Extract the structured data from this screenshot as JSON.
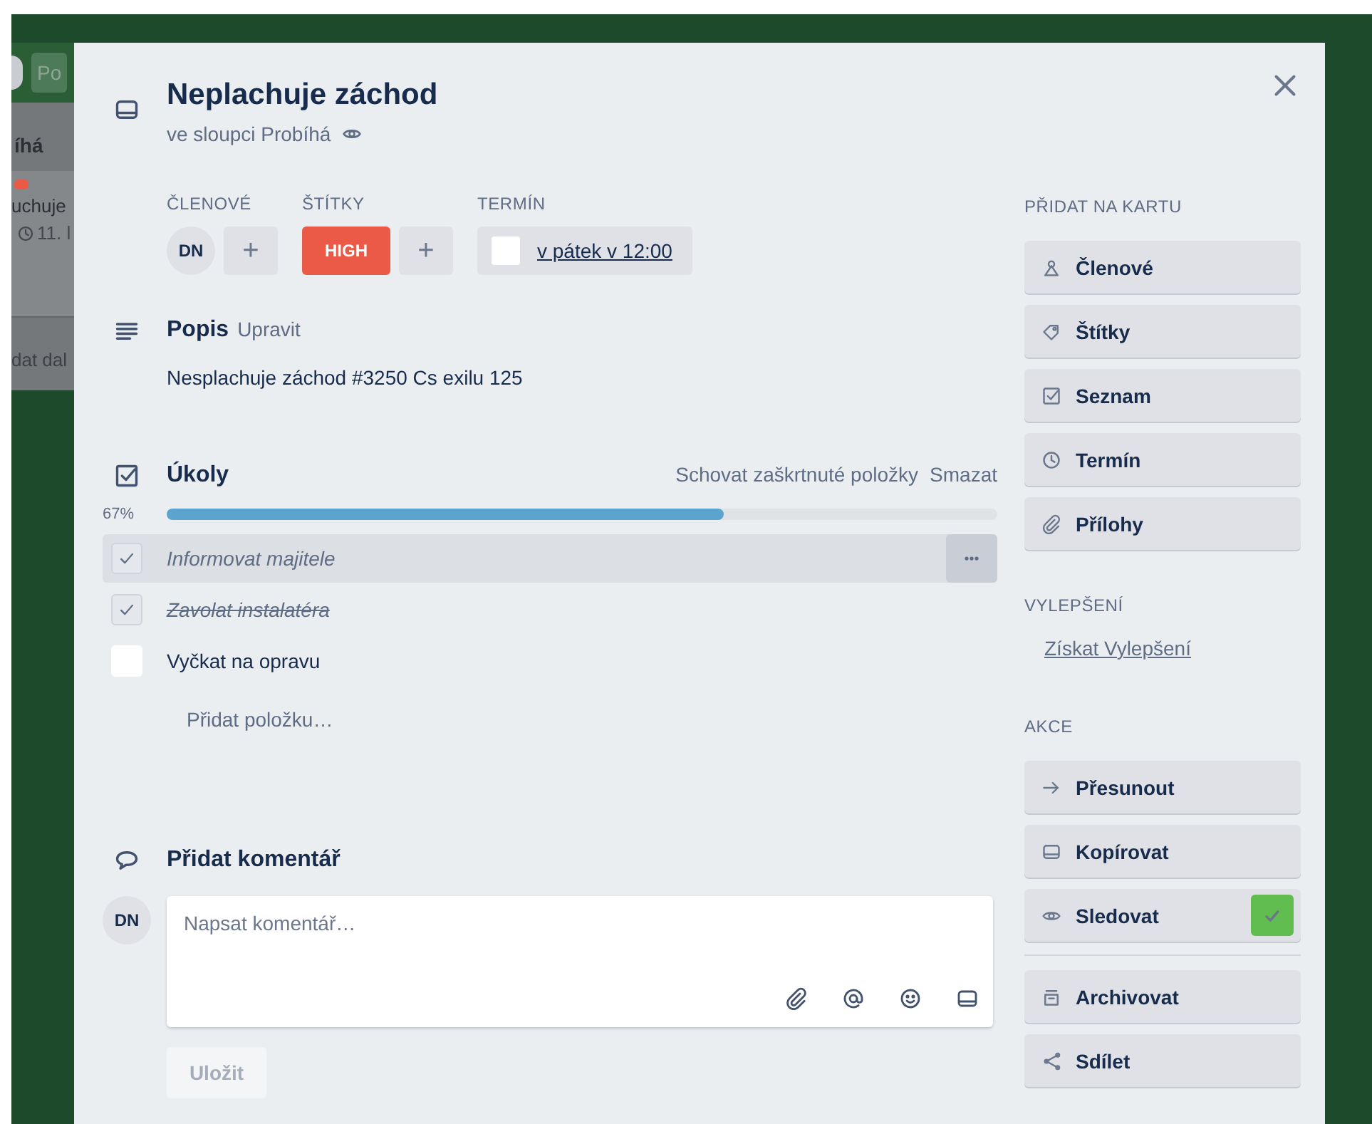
{
  "board": {
    "header_button": "Po",
    "list_title": "íhá",
    "card": {
      "color": "#eb5a46",
      "title": "uchuje",
      "due": "11. l"
    },
    "add_card": "dat dal"
  },
  "card": {
    "title": "Neplachuje záchod",
    "list": "ve sloupci Probíhá",
    "watching": true,
    "members": {
      "heading": "ČLENOVÉ",
      "avatars": [
        "DN"
      ],
      "add": "+"
    },
    "labels": {
      "heading": "ŠTÍTKY",
      "items": [
        {
          "text": "HIGH",
          "color": "#eb5a46"
        }
      ],
      "add": "+"
    },
    "due": {
      "heading": "TERMÍN",
      "text": "v pátek v 12:00",
      "complete": false
    },
    "description": {
      "heading": "Popis",
      "edit": "Upravit",
      "text": "Nesplachuje záchod #3250 Cs exilu 125"
    },
    "checklist": {
      "title": "Úkoly",
      "hide_checked": "Schovat zaškrtnuté položky",
      "delete": "Smazat",
      "percent": "67%",
      "level": 0.67,
      "items": [
        {
          "text": "Informovat majitele",
          "checked": true,
          "highlighted": true
        },
        {
          "text": "Zavolat instalatéra",
          "checked": true,
          "highlighted": false
        },
        {
          "text": "Vyčkat na opravu",
          "checked": false,
          "highlighted": false
        }
      ],
      "add_item": "Přidat položku…"
    },
    "comment": {
      "heading": "Přidat komentář",
      "avatar": "DN",
      "placeholder": "Napsat komentář…",
      "save": "Uložit",
      "save_disabled": true
    }
  },
  "sidebar": {
    "sections": [
      {
        "heading": "PŘIDAT NA KARTU",
        "items": [
          {
            "kind": "button",
            "label": "Členové",
            "checked": false
          },
          {
            "kind": "button",
            "label": "Štítky",
            "checked": false
          },
          {
            "kind": "button",
            "label": "Seznam",
            "checked": false
          },
          {
            "kind": "button",
            "label": "Termín",
            "checked": false
          },
          {
            "kind": "button",
            "label": "Přílohy",
            "checked": false
          }
        ]
      },
      {
        "heading": "VYLEPŠENÍ",
        "items": [
          {
            "kind": "link",
            "label": "Získat Vylepšení"
          }
        ]
      },
      {
        "heading": "AKCE",
        "items": [
          {
            "kind": "button",
            "label": "Přesunout",
            "checked": false
          },
          {
            "kind": "button",
            "label": "Kopírovat",
            "checked": false
          },
          {
            "kind": "button",
            "label": "Sledovat",
            "checked": true
          }
        ]
      },
      {
        "items": [
          {
            "kind": "button",
            "label": "Archivovat",
            "checked": false
          },
          {
            "kind": "button",
            "label": "Sdílet",
            "checked": false
          }
        ]
      }
    ]
  }
}
